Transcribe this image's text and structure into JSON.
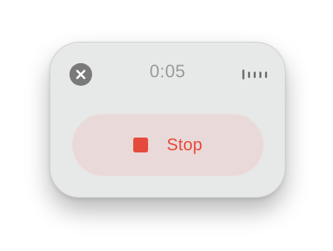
{
  "recorder": {
    "elapsed_time": "0:05",
    "stop_label": "Stop",
    "close_icon": "close-x-circle-icon",
    "stop_icon": "stop-square-icon",
    "level_icon": "audio-level-meter-icon",
    "level_bars": [
      14,
      9,
      9,
      9,
      9
    ]
  },
  "colors": {
    "panel_background": "#e7e8e8",
    "stop_accent": "#e54b3c",
    "stop_button_background": "#ead9d9",
    "close_button": "#7a7a7a",
    "timer_text": "#9a9a9a"
  }
}
